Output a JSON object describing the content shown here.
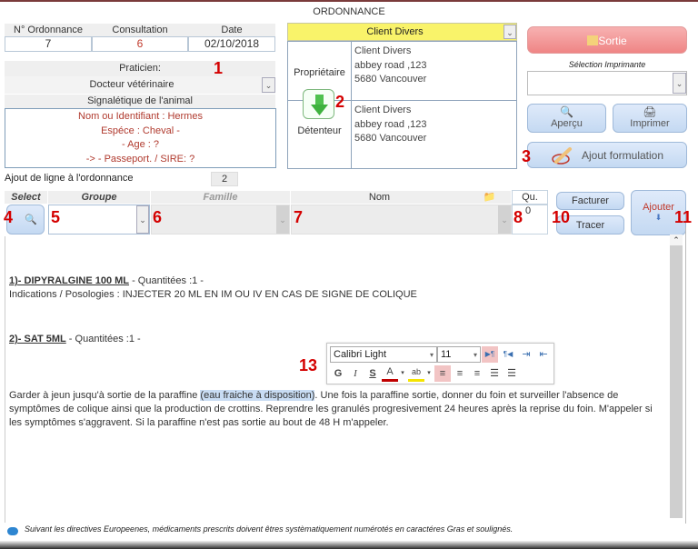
{
  "window": {
    "title": "ORDONNANCE"
  },
  "header": {
    "ordonnance_label": "N° Ordonnance",
    "ordonnance_value": "7",
    "consultation_label": "Consultation",
    "consultation_value": "6",
    "date_label": "Date",
    "date_value": "02/10/2018"
  },
  "praticien": {
    "label": "Praticien:",
    "value": "Docteur vétérinaire"
  },
  "animal": {
    "label": "Signalétique de l'animal",
    "lines": [
      "Nom ou Identifiant : Hermes",
      "Espéce : Cheval -",
      "- Age : ?",
      "-> - Passeport. / SIRE: ?"
    ]
  },
  "client": {
    "selected": "Client Divers",
    "proprietaire_label": "Propriétaire",
    "detenteur_label": "Détenteur",
    "proprietaire": [
      "Client Divers",
      "abbey road ,123",
      "5680  Vancouver"
    ],
    "detenteur": [
      "Client Divers",
      "abbey road ,123",
      "5680  Vancouver"
    ]
  },
  "actions": {
    "sortie": "Sortie",
    "imprimante_label": "Sélection  Imprimante",
    "imprimante_value": "",
    "apercu": "Aperçu",
    "imprimer": "Imprimer",
    "ajout_formulation": "Ajout formulation"
  },
  "ajout_ligne": {
    "label": "Ajout de ligne à  l'ordonnance",
    "value": "2"
  },
  "line_entry": {
    "select_label": "Select",
    "groupe_label": "Groupe",
    "famille_label": "Famille",
    "nom_label": "Nom",
    "qu_label": "Qu.",
    "qu_value": "0",
    "groupe_value": "",
    "famille_value": "",
    "nom_value": "",
    "facturer": "Facturer",
    "tracer": "Tracer",
    "ajouter": "Ajouter"
  },
  "annotations": [
    "1",
    "2",
    "3",
    "4",
    "5",
    "6",
    "7",
    "8",
    "10",
    "11",
    "13"
  ],
  "document": {
    "item1_title": "1)- DIPYRALGINE 100 ML",
    "item1_qty": " - Quantitées :1 -",
    "item1_indications": "Indications / Posologies : INJECTER 20 ML EN IM OU IV EN CAS DE SIGNE DE COLIQUE",
    "item2_title": "2)- SAT 5ML",
    "item2_qty": " - Quantitées :1 -",
    "para_before": "Garder à jeun jusqu'à sortie de la paraffine ",
    "para_selected": "(eau fraiche à disposition)",
    "para_after": ". Une fois la paraffine sortie, donner du foin et surveiller l'absence de symptômes de colique ainsi que la production de crottins. Reprendre les granulés progresivement 24 heures après la reprise du foin. M'appeler si les symptômes s'aggravent. Si la paraffine n'est pas sortie au bout de 48 H m'appeler."
  },
  "format_toolbar": {
    "font": "Calibri Light",
    "size": "11",
    "bold": "G",
    "italic": "I",
    "strike": "S",
    "font_color": "A",
    "highlight": "ab"
  },
  "footer": {
    "note": "Suivant les directives Europeenes, médicaments prescrits doivent êtres systèmatiquement numérotés en caractéres Gras et soulignés."
  },
  "colors": {
    "accent_red": "#d40000",
    "client_yellow": "#f9f36a",
    "sortie_red": "#ef8585",
    "button_blue": "#c4d9f2",
    "selection_blue": "#c8dcf3"
  }
}
